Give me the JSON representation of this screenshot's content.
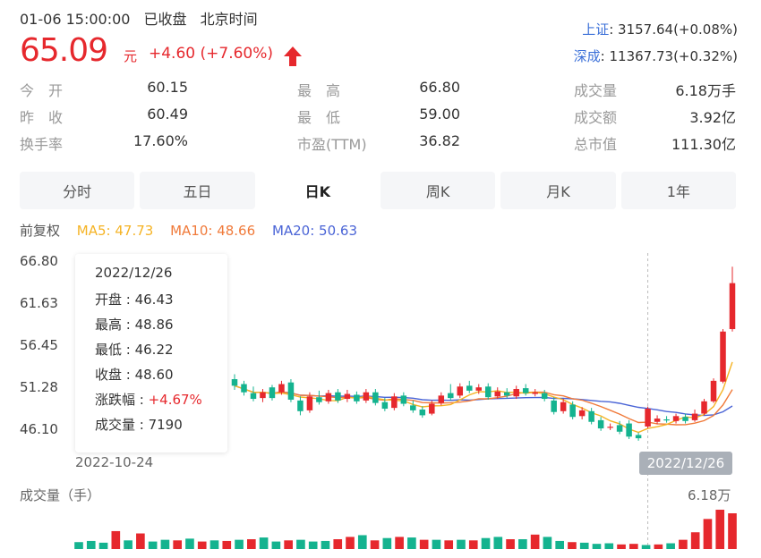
{
  "header": {
    "datetime": "01-06 15:00:00",
    "status": "已收盘",
    "timezone": "北京时间"
  },
  "quote": {
    "price": "65.09",
    "unit": "元",
    "change": "+4.60 (+7.60%)",
    "direction_icon": "arrow-up-icon"
  },
  "indices": [
    {
      "name": "上证",
      "value": ": 3157.64(+0.08%)"
    },
    {
      "name": "深成",
      "value": ": 11367.73(+0.32%)"
    }
  ],
  "stats": {
    "open_label": "今　开",
    "open_value": "60.15",
    "prev_close_label": "昨　收",
    "prev_close_value": "60.49",
    "turnover_rate_label": "换手率",
    "turnover_rate_value": "17.60%",
    "high_label": "最　高",
    "high_value": "66.80",
    "low_label": "最　低",
    "low_value": "59.00",
    "pe_label": "市盈(TTM)",
    "pe_value": "36.82",
    "volume_label": "成交量",
    "volume_value": "6.18万手",
    "amount_label": "成交额",
    "amount_value": "3.92亿",
    "market_cap_label": "总市值",
    "market_cap_value": "111.30亿"
  },
  "tabs": [
    {
      "label": "分时",
      "active": false
    },
    {
      "label": "五日",
      "active": false
    },
    {
      "label": "日K",
      "active": true
    },
    {
      "label": "周K",
      "active": false
    },
    {
      "label": "月K",
      "active": false
    },
    {
      "label": "1年",
      "active": false
    }
  ],
  "ma": {
    "adjust_label": "前复权",
    "ma5": "MA5: 47.73",
    "ma10": "MA10: 48.66",
    "ma20": "MA20: 50.63"
  },
  "colors": {
    "up": "#e6282d",
    "down": "#14b38f",
    "ma5": "#f5b324",
    "ma10": "#f07a3a",
    "ma20": "#4a64d6"
  },
  "tooltip": {
    "date": "2022/12/26",
    "open": "开盘 : 46.43",
    "high": "最高 : 48.86",
    "low": "最低 : 46.22",
    "close": "收盘 : 48.60",
    "change_label": "涨跌幅 : ",
    "change_value": "+4.67%",
    "volume": "成交量 : 7190"
  },
  "axis": {
    "y_ticks": [
      "66.80",
      "61.63",
      "56.45",
      "51.28",
      "46.10"
    ],
    "x_start": "2022-10-24",
    "x_current": "2022/12/26"
  },
  "volume_panel": {
    "title": "成交量（手）",
    "max_label": "6.18万"
  },
  "chart_data": {
    "type": "candlestick",
    "ylim": [
      46.1,
      66.8
    ],
    "candles": [
      {
        "o": 52.2,
        "c": 51.4,
        "h": 52.8,
        "l": 50.9
      },
      {
        "o": 51.6,
        "c": 50.6,
        "h": 52.0,
        "l": 50.2
      },
      {
        "o": 50.5,
        "c": 49.8,
        "h": 51.3,
        "l": 49.5
      },
      {
        "o": 49.9,
        "c": 50.6,
        "h": 51.0,
        "l": 49.4
      },
      {
        "o": 51.2,
        "c": 49.9,
        "h": 51.5,
        "l": 49.6
      },
      {
        "o": 50.6,
        "c": 51.6,
        "h": 52.0,
        "l": 50.3
      },
      {
        "o": 51.8,
        "c": 49.7,
        "h": 52.2,
        "l": 49.4
      },
      {
        "o": 49.6,
        "c": 48.3,
        "h": 50.1,
        "l": 47.8
      },
      {
        "o": 48.4,
        "c": 50.1,
        "h": 50.6,
        "l": 48.1
      },
      {
        "o": 50.0,
        "c": 49.4,
        "h": 50.8,
        "l": 49.1
      },
      {
        "o": 49.5,
        "c": 50.5,
        "h": 50.9,
        "l": 49.2
      },
      {
        "o": 50.6,
        "c": 49.6,
        "h": 51.0,
        "l": 49.3
      },
      {
        "o": 49.8,
        "c": 50.4,
        "h": 50.9,
        "l": 49.4
      },
      {
        "o": 50.3,
        "c": 49.5,
        "h": 50.7,
        "l": 49.2
      },
      {
        "o": 49.6,
        "c": 50.6,
        "h": 51.0,
        "l": 49.3
      },
      {
        "o": 50.6,
        "c": 49.3,
        "h": 51.0,
        "l": 49.0
      },
      {
        "o": 49.4,
        "c": 48.6,
        "h": 49.9,
        "l": 48.3
      },
      {
        "o": 48.7,
        "c": 50.1,
        "h": 50.5,
        "l": 48.4
      },
      {
        "o": 50.2,
        "c": 49.2,
        "h": 50.6,
        "l": 48.9
      },
      {
        "o": 49.0,
        "c": 48.4,
        "h": 49.6,
        "l": 48.1
      },
      {
        "o": 48.5,
        "c": 47.8,
        "h": 48.9,
        "l": 47.5
      },
      {
        "o": 48.0,
        "c": 49.2,
        "h": 49.6,
        "l": 47.8
      },
      {
        "o": 49.3,
        "c": 50.2,
        "h": 50.6,
        "l": 49.0
      },
      {
        "o": 50.5,
        "c": 49.9,
        "h": 51.6,
        "l": 49.6
      },
      {
        "o": 50.2,
        "c": 51.3,
        "h": 51.7,
        "l": 49.9
      },
      {
        "o": 51.4,
        "c": 50.8,
        "h": 52.0,
        "l": 50.5
      },
      {
        "o": 50.8,
        "c": 51.2,
        "h": 51.6,
        "l": 50.4
      },
      {
        "o": 51.3,
        "c": 50.0,
        "h": 51.7,
        "l": 49.7
      },
      {
        "o": 50.1,
        "c": 50.7,
        "h": 51.2,
        "l": 49.8
      },
      {
        "o": 50.6,
        "c": 50.2,
        "h": 51.1,
        "l": 49.9
      },
      {
        "o": 50.1,
        "c": 51.0,
        "h": 51.4,
        "l": 49.8
      },
      {
        "o": 51.1,
        "c": 50.5,
        "h": 51.6,
        "l": 50.2
      },
      {
        "o": 50.4,
        "c": 50.6,
        "h": 51.0,
        "l": 50.1
      },
      {
        "o": 50.5,
        "c": 49.8,
        "h": 50.9,
        "l": 49.5
      },
      {
        "o": 49.6,
        "c": 48.2,
        "h": 50.0,
        "l": 47.9
      },
      {
        "o": 48.3,
        "c": 49.4,
        "h": 49.8,
        "l": 48.0
      },
      {
        "o": 49.1,
        "c": 47.6,
        "h": 49.5,
        "l": 47.3
      },
      {
        "o": 47.7,
        "c": 48.4,
        "h": 48.8,
        "l": 47.3
      },
      {
        "o": 48.3,
        "c": 47.0,
        "h": 48.7,
        "l": 46.7
      },
      {
        "o": 47.2,
        "c": 46.2,
        "h": 47.6,
        "l": 45.9
      },
      {
        "o": 46.4,
        "c": 46.4,
        "h": 46.8,
        "l": 46.0
      },
      {
        "o": 46.6,
        "c": 45.8,
        "h": 47.1,
        "l": 45.5
      },
      {
        "o": 46.8,
        "c": 45.2,
        "h": 47.2,
        "l": 44.9
      },
      {
        "o": 45.4,
        "c": 45.0,
        "h": 45.7,
        "l": 44.7
      },
      {
        "o": 46.43,
        "c": 48.6,
        "h": 48.86,
        "l": 46.22
      },
      {
        "o": 47.0,
        "c": 47.4,
        "h": 47.8,
        "l": 46.7
      },
      {
        "o": 47.3,
        "c": 47.2,
        "h": 47.7,
        "l": 46.9
      },
      {
        "o": 47.1,
        "c": 47.7,
        "h": 48.0,
        "l": 46.8
      },
      {
        "o": 47.6,
        "c": 47.1,
        "h": 48.0,
        "l": 46.8
      },
      {
        "o": 47.2,
        "c": 48.0,
        "h": 48.5,
        "l": 47.0
      },
      {
        "o": 48.0,
        "c": 49.5,
        "h": 49.8,
        "l": 47.8
      },
      {
        "o": 49.5,
        "c": 52.0,
        "h": 52.3,
        "l": 49.3
      },
      {
        "o": 51.9,
        "c": 58.0,
        "h": 58.3,
        "l": 51.7
      },
      {
        "o": 58.3,
        "c": 63.9,
        "h": 65.9,
        "l": 58.0
      }
    ],
    "volumes": [
      1200,
      1400,
      1100,
      3100,
      1500,
      2700,
      1300,
      1600,
      1500,
      1800,
      1300,
      1500,
      1400,
      1600,
      1700,
      2000,
      1300,
      1500,
      1600,
      1300,
      1400,
      1700,
      2100,
      2400,
      1500,
      1900,
      2100,
      2000,
      1600,
      1600,
      1500,
      1600,
      1500,
      1900,
      2100,
      1700,
      1700,
      2500,
      2100,
      1400,
      1200,
      1100,
      900,
      1000,
      800,
      900,
      700,
      800,
      1000,
      1600,
      2900,
      5200,
      6800,
      6180
    ]
  }
}
